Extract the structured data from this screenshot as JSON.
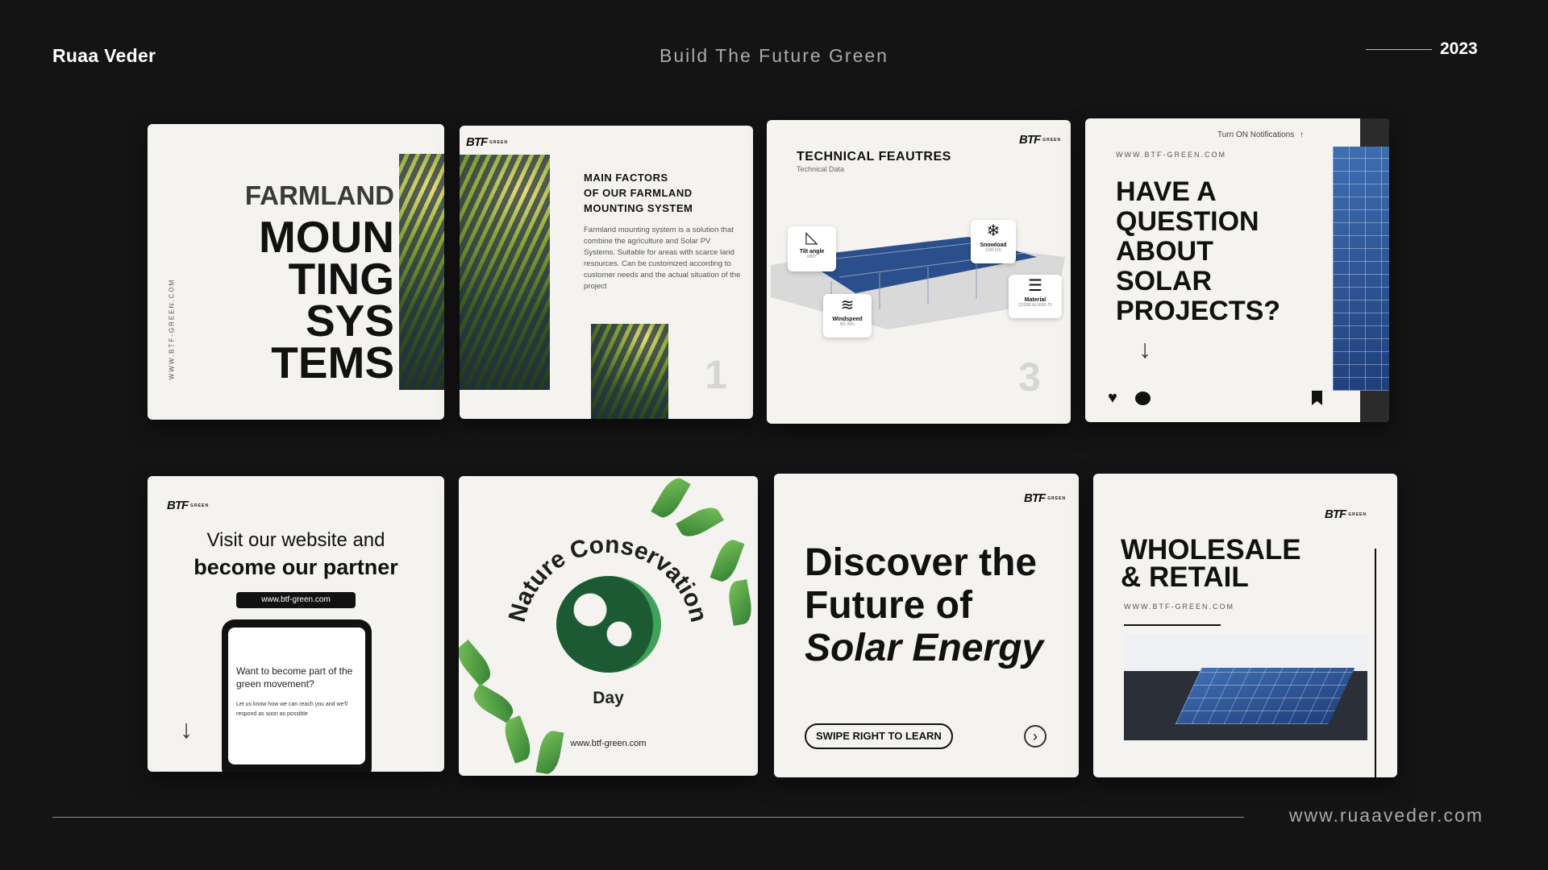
{
  "header": {
    "author": "Ruaa Veder",
    "tagline": "Build The Future Green",
    "year": "2023"
  },
  "footer": {
    "website": "www.ruaaveder.com"
  },
  "brand": {
    "logo": "BTF",
    "logo_sub": "GREEN"
  },
  "card1": {
    "line1": "FARMLAND",
    "words": [
      "MOUN",
      "TING",
      "SYS",
      "TEMS"
    ],
    "url": "WWW.BTF-GREEN.COM"
  },
  "card2": {
    "title": [
      "MAIN FACTORS",
      "OF OUR FARMLAND",
      "MOUNTING SYSTEM"
    ],
    "body": "Farmland mounting system is a solution that combine the agriculture and Solar PV Systems. Suitable for areas with scarce land resources. Can be customized according to customer needs and the actual situation of the project",
    "number": "1"
  },
  "card3": {
    "title": "TECHNICAL FEAUTRES",
    "subtitle": "Technical Data",
    "specs": [
      {
        "label": "Tilt angle",
        "value": "≤60°"
      },
      {
        "label": "Snowload",
        "value": "100 cm"
      },
      {
        "label": "Material",
        "value": "Q235B,AL6005-T5"
      },
      {
        "label": "Windspeed",
        "value": "60 m/s"
      }
    ],
    "number": "3"
  },
  "card4": {
    "notify": "Turn ON Notifications",
    "url": "WWW.BTF-GREEN.COM",
    "lines": [
      "HAVE A",
      "QUESTION",
      "ABOUT",
      "SOLAR",
      "PROJECTS?"
    ]
  },
  "card5": {
    "line1": "Visit our website and",
    "line2": "become our partner",
    "pill": "www.btf-green.com",
    "phone_title": "Want to become part of the green movement?",
    "phone_body": "Let us know how we can reach you and we'll respond as soon as possible"
  },
  "card6": {
    "arc": "Nature Conservation",
    "day": "Day",
    "url": "www.btf-green.com"
  },
  "card7": {
    "line1": "Discover the",
    "line2": "Future of",
    "line3": "Solar Energy",
    "cta": "SWIPE RIGHT TO LEARN"
  },
  "card8": {
    "line1": "WHOLESALE",
    "line2": "& RETAIL",
    "url": "WWW.BTF-GREEN.COM"
  },
  "colors": {
    "background": "#141414",
    "card": "#f4f3ef",
    "green": "#2e7d32",
    "dark_green": "#1b4d2b"
  }
}
